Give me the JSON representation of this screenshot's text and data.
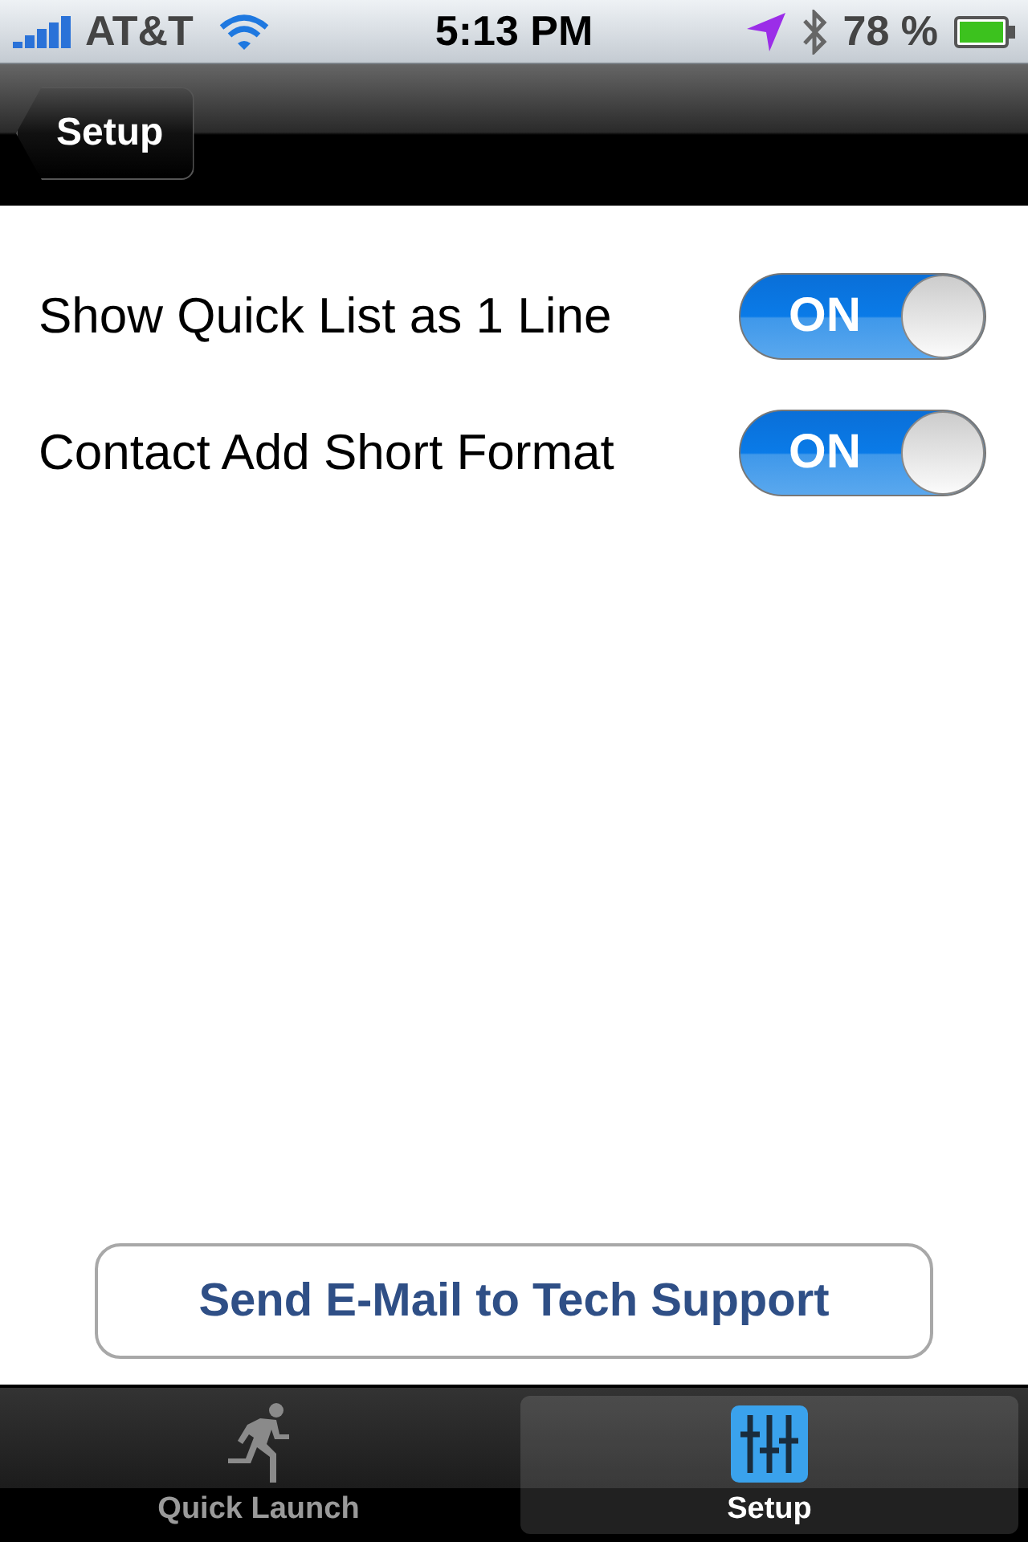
{
  "status_bar": {
    "carrier": "AT&T",
    "time": "5:13 PM",
    "battery": "78 %"
  },
  "nav_bar": {
    "back_button": "Setup"
  },
  "settings": [
    {
      "label": "Show Quick List as 1 Line",
      "switch_text": "ON",
      "on": true
    },
    {
      "label": "Contact Add Short Format",
      "switch_text": "ON",
      "on": true
    }
  ],
  "support_button": "Send E-Mail to Tech Support",
  "tab_bar": [
    {
      "label": "Quick Launch",
      "kind": "run",
      "selected": false
    },
    {
      "label": "Setup",
      "kind": "sliders",
      "selected": true
    }
  ]
}
